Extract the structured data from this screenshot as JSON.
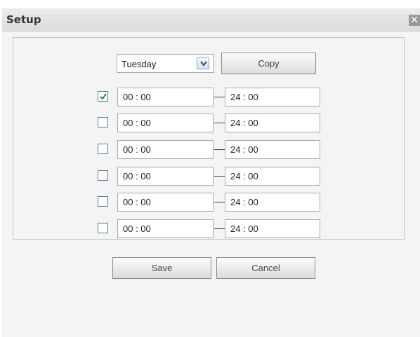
{
  "dialog": {
    "title": "Setup",
    "close_glyph": "✕"
  },
  "day_selector": {
    "selected": "Tuesday",
    "copy_label": "Copy"
  },
  "periods": [
    {
      "enabled": true,
      "start": "00 : 00",
      "end": "24 : 00"
    },
    {
      "enabled": false,
      "start": "00 : 00",
      "end": "24 : 00"
    },
    {
      "enabled": false,
      "start": "00 : 00",
      "end": "24 : 00"
    },
    {
      "enabled": false,
      "start": "00 : 00",
      "end": "24 : 00"
    },
    {
      "enabled": false,
      "start": "00 : 00",
      "end": "24 : 00"
    },
    {
      "enabled": false,
      "start": "00 : 00",
      "end": "24 : 00"
    }
  ],
  "footer": {
    "save_label": "Save",
    "cancel_label": "Cancel"
  },
  "colors": {
    "check_mark": "#2e8b2e"
  }
}
